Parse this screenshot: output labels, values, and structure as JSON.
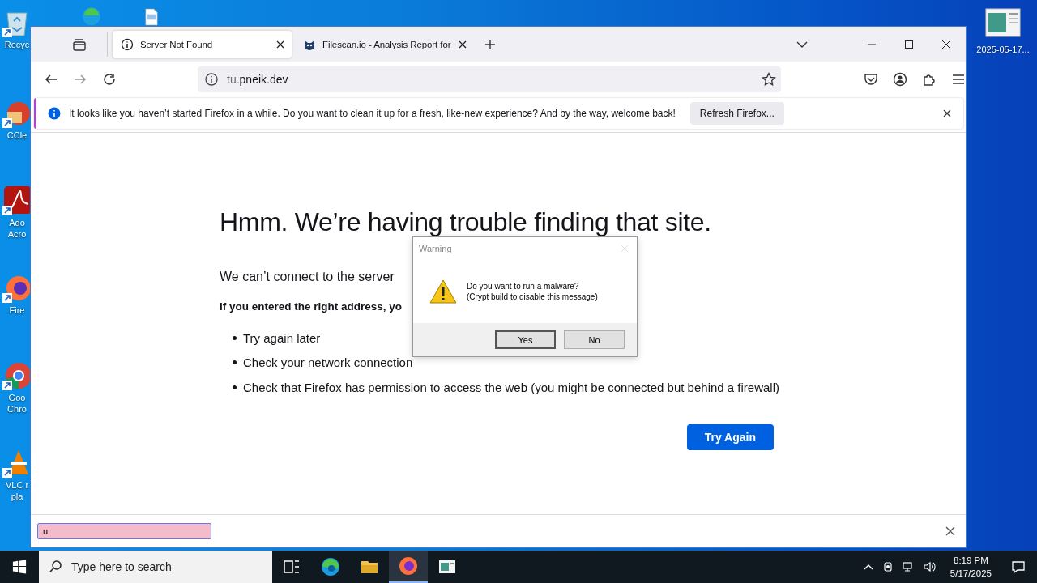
{
  "desktop": {
    "left_icons": [
      {
        "kind": "recycle",
        "label": "Recyc"
      },
      {
        "kind": "ccleaner",
        "label": "CCle"
      },
      {
        "kind": "acrobat",
        "label": "Ado\nAcro"
      },
      {
        "kind": "firefox",
        "label": "Fire"
      },
      {
        "kind": "chrome",
        "label": "Goo\nChro"
      },
      {
        "kind": "vlc",
        "label": "VLC r\npla"
      }
    ],
    "right_icon": {
      "label": "2025-05-17..."
    }
  },
  "browser": {
    "tabs": [
      {
        "kind": "info",
        "title": "Server Not Found",
        "selected": true
      },
      {
        "kind": "site",
        "title": "Filescan.io - Analysis Report for",
        "selected": false
      }
    ],
    "address": {
      "prefix": "tu.",
      "domain": "pneik.dev"
    },
    "notification": {
      "text": "It looks like you haven’t started Firefox in a while. Do you want to clean it up for a fresh, like-new experience? And by the way, welcome back!",
      "button": "Refresh Firefox..."
    },
    "page": {
      "title": "Hmm. We’re having trouble finding that site.",
      "intro": "We can’t connect to the server",
      "hint": "If you entered the right address, yo",
      "bullets": [
        "Try again later",
        "Check your network connection",
        "Check that Firefox has permission to access the web (you might be connected but behind a firewall)"
      ],
      "button": "Try Again"
    },
    "find_bar": {
      "value": "u"
    }
  },
  "dialog": {
    "title": "Warning",
    "message": [
      "Do you want to run a malware?",
      "(Crypt build to disable this message)"
    ],
    "buttons": [
      {
        "label": "Yes",
        "selected": true
      },
      {
        "label": "No",
        "selected": false
      }
    ]
  },
  "taskbar": {
    "search_placeholder": "Type here to search",
    "apps": [
      {
        "kind": "taskview",
        "active": false
      },
      {
        "kind": "edge",
        "active": false
      },
      {
        "kind": "explorer",
        "active": false
      },
      {
        "kind": "firefox",
        "active": true
      },
      {
        "kind": "window",
        "active": false
      }
    ],
    "time": "8:19 PM",
    "date": "5/17/2025"
  }
}
